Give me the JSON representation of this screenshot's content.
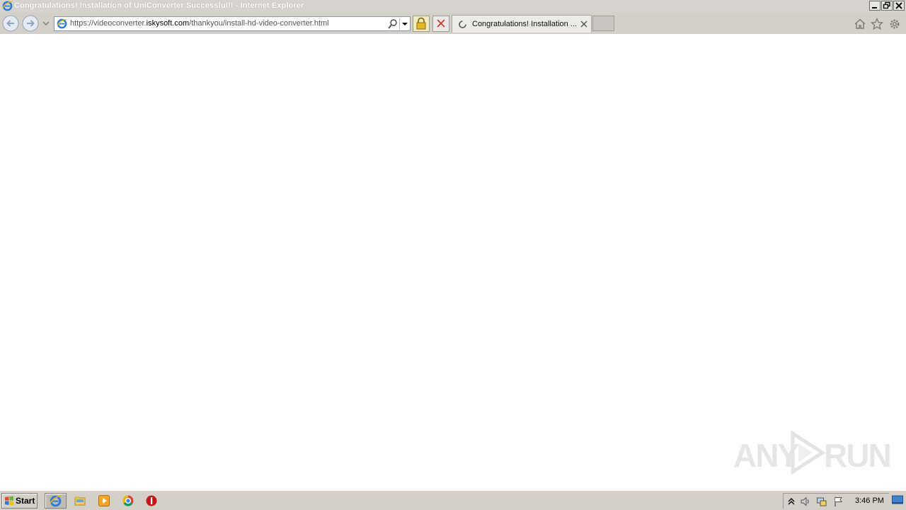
{
  "window": {
    "title": "Congratulations! Installation of UniConverter Successful!! - Internet Explorer",
    "controls": [
      "minimize-icon",
      "restore-icon",
      "close-icon"
    ]
  },
  "address_bar": {
    "url_prefix": "https://videoconverter.",
    "url_host": "iskysoft.com",
    "url_path": "/thankyou/install-hd-video-converter.html"
  },
  "tabs": [
    {
      "title": "Congratulations! Installation ...",
      "loading": true
    }
  ],
  "toolbar_icons": [
    "home-icon",
    "favorites-star-icon",
    "tools-gear-icon"
  ],
  "content": {
    "watermark_left": "ANY",
    "watermark_right": "RUN"
  },
  "taskbar": {
    "start_label": "Start",
    "pinned": [
      "internet-explorer-icon",
      "explorer-folder-icon",
      "media-player-icon",
      "chrome-icon",
      "stop-sign-icon"
    ],
    "tray_icons": [
      "show-hidden-icons-arrow",
      "volume-icon",
      "network-icon",
      "action-center-flag-icon"
    ],
    "clock": "3:46 PM"
  },
  "colors": {
    "chrome_gray": "#d4d0c8",
    "accent_blue": "#1c6dc9",
    "url_host_black": "#000000"
  }
}
